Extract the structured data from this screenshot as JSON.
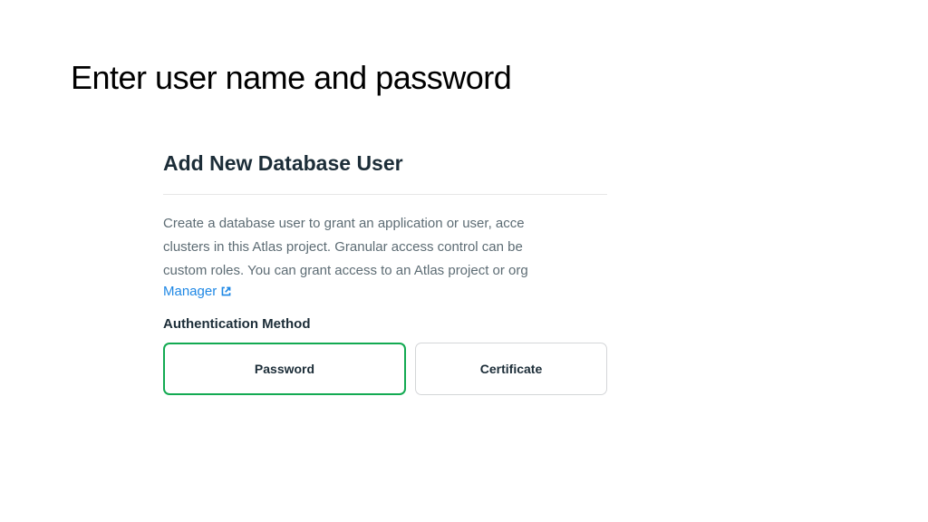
{
  "slide": {
    "title": "Enter user name and password"
  },
  "panel": {
    "heading": "Add New Database User",
    "description": {
      "line1": "Create a database user to grant an application or user, acce",
      "line2": "clusters in this Atlas project. Granular access control can be ",
      "line3": "custom roles. You can grant access to an Atlas project or org"
    },
    "link": {
      "label": "Manager"
    },
    "auth": {
      "section_label": "Authentication Method",
      "options": {
        "password": "Password",
        "certificate": "Certificate"
      }
    }
  }
}
